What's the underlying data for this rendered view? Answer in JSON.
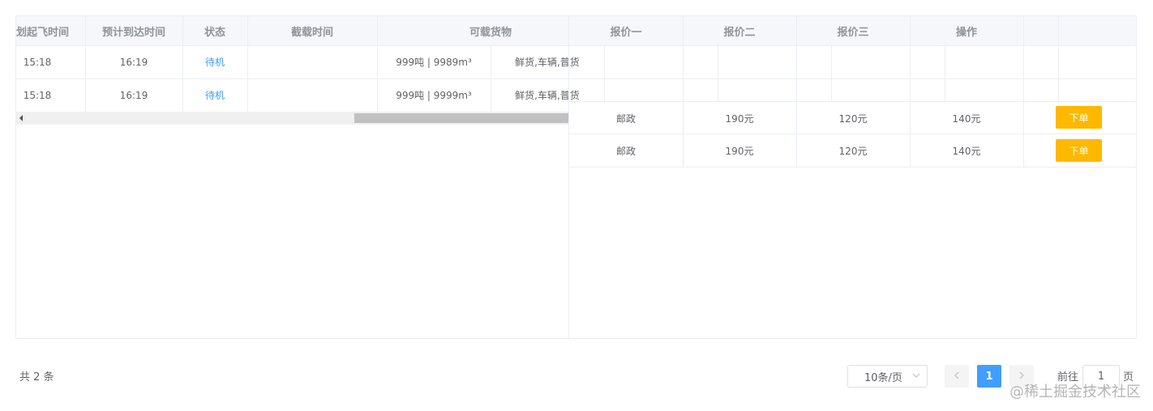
{
  "left_table": {
    "headers": [
      "划起飞时间",
      "预计到达时间",
      "状态",
      "截载时间",
      "可载货物"
    ],
    "rows": [
      {
        "takeoff": "15:18",
        "arrival": "16:19",
        "status": "待机",
        "cutoff": "",
        "capacity": "999吨 | 9989m³",
        "goods": "鲜货,车辆,普货"
      },
      {
        "takeoff": "15:18",
        "arrival": "16:19",
        "status": "待机",
        "cutoff": "",
        "capacity": "999吨 | 9999m³",
        "goods": "鲜货,车辆,普货"
      }
    ]
  },
  "right_table": {
    "headers": [
      "报价一",
      "报价二",
      "报价三",
      "操作"
    ],
    "rows": [
      {
        "carrier": "邮政",
        "quote1": "190元",
        "quote2": "120元",
        "quote3": "140元",
        "action": "下单"
      },
      {
        "carrier": "邮政",
        "quote1": "190元",
        "quote2": "120元",
        "quote3": "140元",
        "action": "下单"
      }
    ]
  },
  "pagination": {
    "total_text": "共 2 条",
    "page_size": "10条/页",
    "current_page": "1",
    "goto_prefix": "前往",
    "goto_value": "1",
    "goto_suffix": "页"
  },
  "watermark": "@稀土掘金技术社区",
  "colors": {
    "accent": "#409eff",
    "order_button": "#ffb800",
    "header_bg": "#f5f7fa",
    "border": "#ebeef5"
  }
}
